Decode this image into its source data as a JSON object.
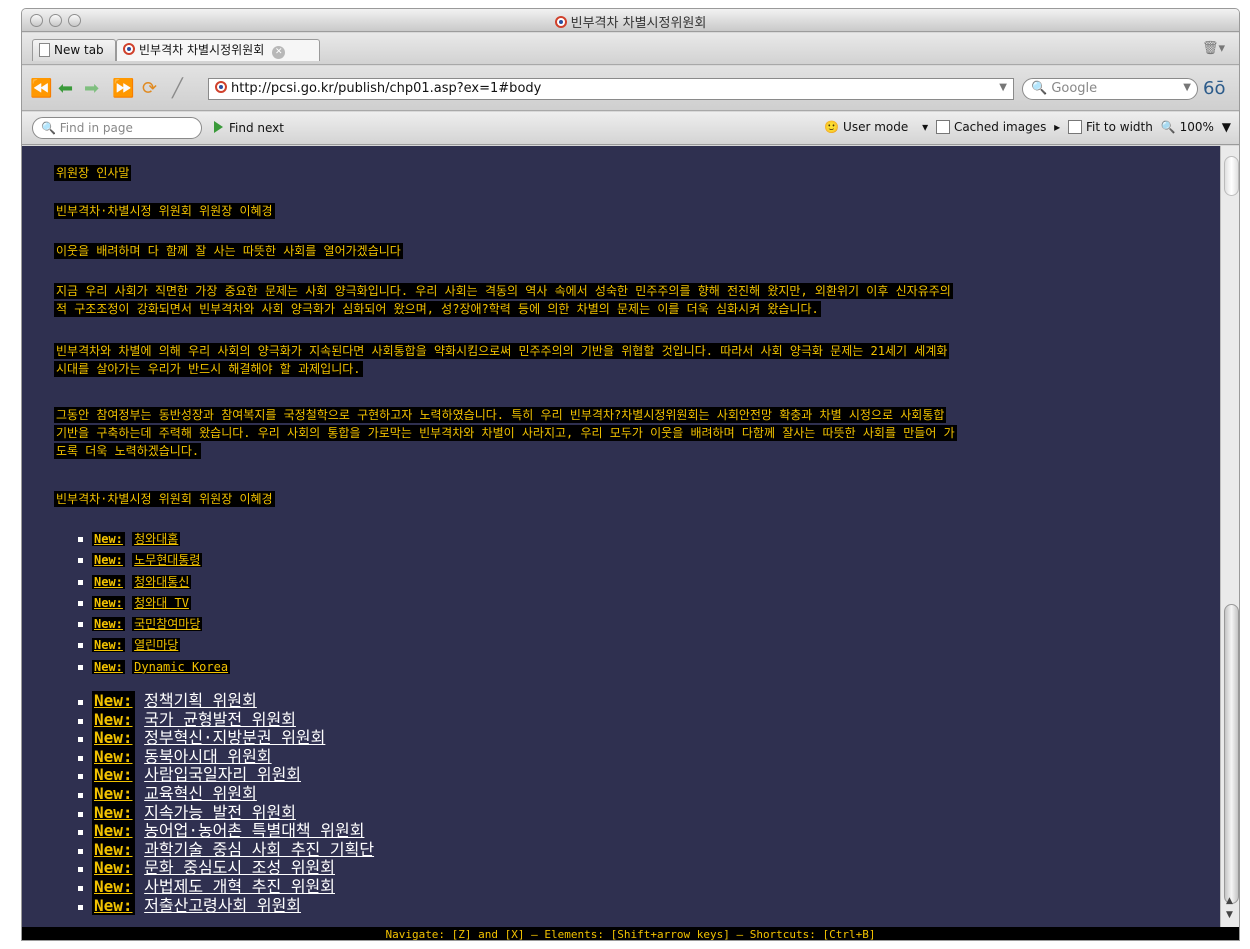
{
  "window": {
    "title": "빈부격차 차별시정위원회"
  },
  "tabs": [
    {
      "label": "New tab"
    },
    {
      "label": "빈부격차 차별시정위원회"
    }
  ],
  "address": {
    "url": "http://pcsi.go.kr/publish/chp01.asp?ex=1#body"
  },
  "search": {
    "placeholder": "Google"
  },
  "findbar": {
    "placeholder": "Find in page",
    "find_next": "Find next",
    "user_mode": "User mode",
    "cached_images": "Cached images",
    "fit_to_width": "Fit to width",
    "zoom": "100%"
  },
  "content": {
    "heading1": "위원장 인사말",
    "heading2": "빈부격차·차별시정 위원회 위원장 이혜경",
    "heading3": "이웃을 배려하며 다 함께 잘 사는 따뜻한 사회를 열어가겠습니다",
    "para1_line1": "지금 우리 사회가 직면한 가장 중요한 문제는 사회 양극화입니다. 우리 사회는 격동의 역사 속에서 성숙한 민주주의를 향해 전진해 왔지만, 외환위기 이후 신자유주의",
    "para1_line2": "적 구조조정이 강화되면서 빈부격차와 사회 양극화가 심화되어 왔으며, 성?장애?학력 등에 의한 차별의 문제는 이를 더욱 심화시켜 왔습니다.",
    "para2_line1": "빈부격차와 차별에 의해 우리 사회의 양극화가 지속된다면 사회통합을 약화시킴으로써 민주주의의 기반을 위협할 것입니다. 따라서 사회 양극화 문제는 21세기 세계화",
    "para2_line2": "시대를 살아가는 우리가 반드시 해결해야 할 과제입니다.",
    "para3_line1": "그동안 참여정부는 동반성장과 참여복지를 국정철학으로 구현하고자 노력하였습니다. 특히 우리 빈부격차?차별시정위원회는 사회안전망 확충과 차별 시정으로 사회통합",
    "para3_line2": "기반을 구축하는데 주력해 왔습니다. 우리 사회의 통합을 가로막는 빈부격차와 차별이 사라지고, 우리 모두가 이웃을 배려하며 다함께 잘사는 따뜻한 사회를 만들어 가",
    "para3_line3": "도록 더욱 노력하겠습니다.",
    "signature": "빈부격차·차별시정 위원회 위원장 이혜경",
    "new_label": "New:",
    "small_links": [
      "청와대홈",
      "노무현대통령",
      "청와대통신",
      "청와대 TV",
      "국민참여마당",
      "열린마당",
      "Dynamic Korea"
    ],
    "big_links": [
      "정책기획 위원회",
      "국가 균형발전 위원회",
      "정부혁신·지방분권 위원회",
      "동북아시대 위원회",
      "사람입국일자리 위원회",
      "교육혁신 위원회",
      "지속가능 발전 위원회",
      "농어업·농어촌 특별대책 위원회",
      "과학기술 중심 사회 추진 기획단",
      "문화 중심도시 조성 위원회",
      "사법제도 개혁 추진 위원회",
      "저출산고령사회 위원회"
    ]
  },
  "status": {
    "text": "Navigate: [Z] and [X] — Elements: [Shift+arrow keys] — Shortcuts: [Ctrl+B]"
  },
  "colors": {
    "content_bg": "#2f3050",
    "highlight_text": "#f2c200",
    "highlight_bg": "#000000"
  }
}
